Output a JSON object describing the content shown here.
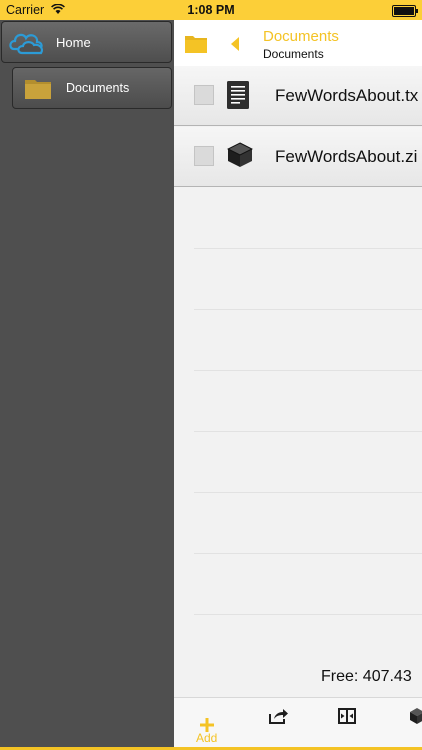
{
  "status_bar": {
    "carrier": "Carrier",
    "time": "1:08 PM",
    "icons": [
      "wifi-icon",
      "battery-icon"
    ]
  },
  "sidebar": {
    "home_label": "Home",
    "home_icon": "cloud-icon",
    "documents_label": "Documents",
    "documents_icon": "folder-icon"
  },
  "header": {
    "title": "Documents",
    "subtitle": "Documents",
    "icons": [
      "folder-icon",
      "back-arrow-icon"
    ]
  },
  "files": [
    {
      "name": "FewWordsAbout.tx",
      "icon": "text-document-icon",
      "checked": false
    },
    {
      "name": "FewWordsAbout.zi",
      "icon": "zip-box-icon",
      "checked": false
    }
  ],
  "footer": {
    "free_space": "Free: 407.43"
  },
  "toolbar": {
    "add_label": "Add",
    "icons": [
      "add-icon",
      "share-icon",
      "move-icon",
      "zip-icon"
    ]
  },
  "colors": {
    "accent": "#F4C325",
    "status_bar": "#FCCF38",
    "sidebar": "#4F4F4F",
    "cloud": "#2C9BD6",
    "folder": "#C9A23B"
  }
}
